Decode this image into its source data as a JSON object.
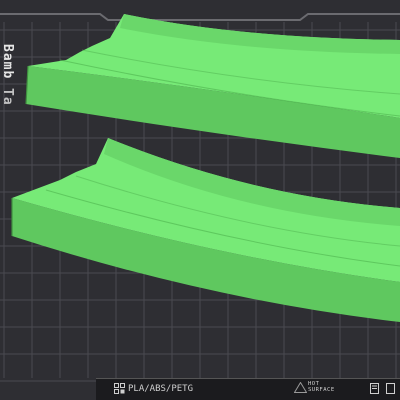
{
  "viewport": {
    "bed_label": [
      "Bamb",
      "Ta"
    ],
    "model_color": "#6ee16e",
    "grid_color": "#4a4a50"
  },
  "bottom_bar": {
    "filament": "PLA/ABS/PETG",
    "surface_line1": "HOT",
    "surface_line2": "SURFACE",
    "filament_icon": "spool-grid-icon",
    "surface_icon": "warning-triangle-icon",
    "right_icon": "document-icon"
  }
}
